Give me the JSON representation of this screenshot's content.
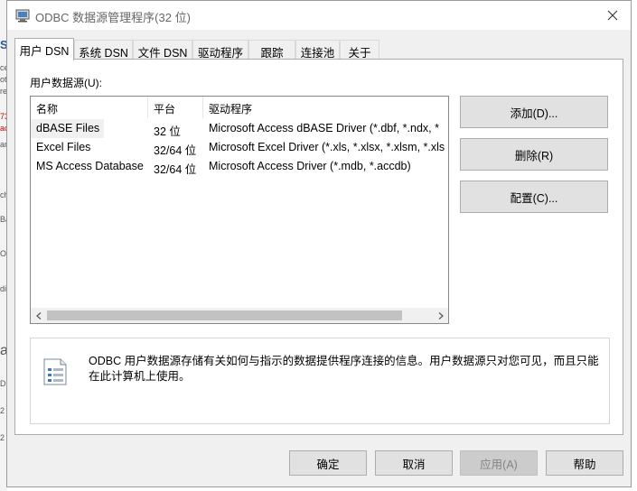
{
  "window": {
    "title": "ODBC 数据源管理程序(32 位)"
  },
  "tabs": [
    {
      "label": "用户 DSN",
      "active": true
    },
    {
      "label": "系统 DSN",
      "active": false
    },
    {
      "label": "文件 DSN",
      "active": false
    },
    {
      "label": "驱动程序",
      "active": false
    },
    {
      "label": "跟踪",
      "active": false
    },
    {
      "label": "连接池",
      "active": false
    },
    {
      "label": "关于",
      "active": false
    }
  ],
  "user_dsn": {
    "list_label": "用户数据源(U):",
    "columns": [
      "名称",
      "平台",
      "驱动程序"
    ],
    "rows": [
      {
        "name": "dBASE Files",
        "platform": "32 位",
        "driver": "Microsoft Access dBASE Driver (*.dbf, *.ndx, *"
      },
      {
        "name": "Excel Files",
        "platform": "32/64 位",
        "driver": "Microsoft Excel Driver (*.xls, *.xlsx, *.xlsm, *.xls"
      },
      {
        "name": "MS Access Database",
        "platform": "32/64 位",
        "driver": "Microsoft Access Driver (*.mdb, *.accdb)"
      }
    ],
    "buttons": {
      "add": "添加(D)...",
      "remove": "删除(R)",
      "configure": "配置(C)..."
    },
    "info_text": "ODBC 用户数据源存储有关如何与指示的数据提供程序连接的信息。用户数据源只对您可见，而且只能在此计算机上使用。"
  },
  "footer": {
    "ok": "确定",
    "cancel": "取消",
    "apply": "应用(A)",
    "help": "帮助"
  },
  "background_text": [
    "SI",
    "ce",
    "ot",
    "re",
    "73",
    "ac",
    "ar",
    "ch",
    "Ba",
    "OD",
    "di",
    "a",
    "D",
    "2",
    "2"
  ],
  "icons": {
    "app": "odbc-app-icon",
    "close": "close-icon",
    "info": "data-source-document-icon",
    "scroll_left": "chevron-left-icon",
    "scroll_right": "chevron-right-icon"
  },
  "colors": {
    "dialog_bg": "#f0f0f0",
    "button_bg": "#e1e1e1",
    "disabled_text": "#838383",
    "title_text": "#666666"
  }
}
